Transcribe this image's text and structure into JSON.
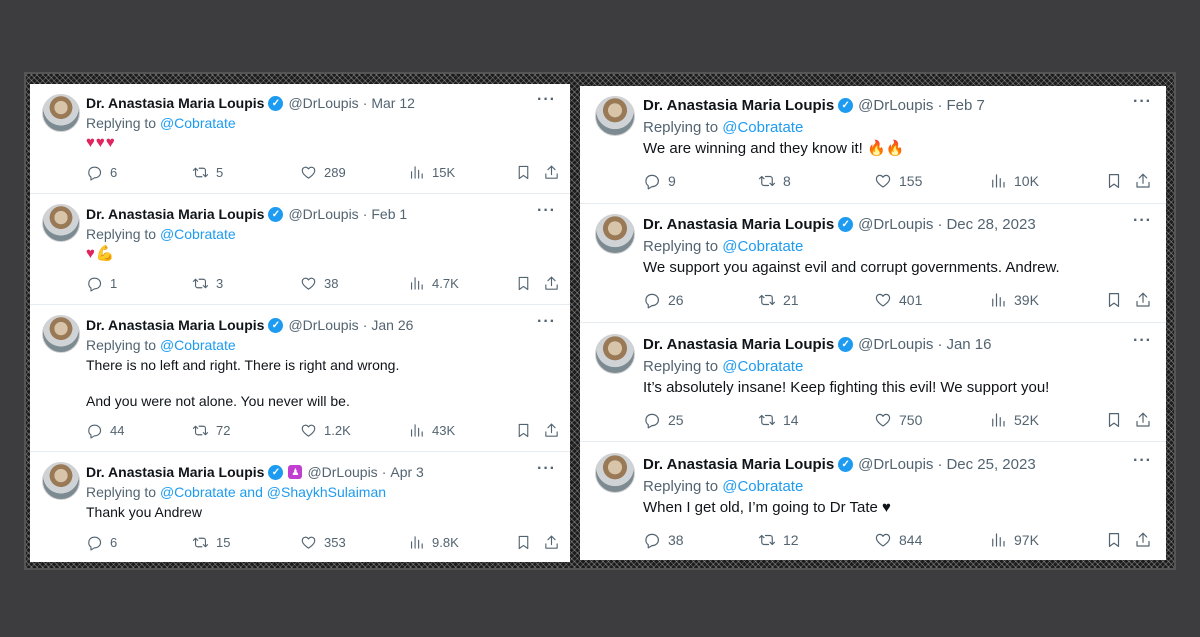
{
  "colors": {
    "link": "#1d9bf0",
    "verified": "#1d9bf0",
    "heart": "#e0245e",
    "text": "#0f1419",
    "muted": "#536471"
  },
  "icons": {
    "reply": "speech-bubble-icon",
    "retweet": "retweet-icon",
    "like": "heart-icon",
    "views": "bar-chart-icon",
    "bookmark": "bookmark-icon",
    "share": "share-upload-icon",
    "more": "ellipsis-icon",
    "verified": "verified-badge-icon"
  },
  "left_tweets": [
    {
      "name": "Dr. Anastasia Maria Loupis",
      "handle": "@DrLoupis",
      "separator": "·",
      "date": "Mar 12",
      "replying_prefix": "Replying to",
      "replying_to": "@Cobratate",
      "text": "♥♥♥",
      "emoji_text": true,
      "replies": "6",
      "retweets": "5",
      "likes": "289",
      "views": "15K"
    },
    {
      "name": "Dr. Anastasia Maria Loupis",
      "handle": "@DrLoupis",
      "separator": "·",
      "date": "Feb 1",
      "replying_prefix": "Replying to",
      "replying_to": "@Cobratate",
      "text": "♥💪",
      "emoji_text": true,
      "replies": "1",
      "retweets": "3",
      "likes": "38",
      "views": "4.7K"
    },
    {
      "name": "Dr. Anastasia Maria Loupis",
      "handle": "@DrLoupis",
      "separator": "·",
      "date": "Jan 26",
      "replying_prefix": "Replying to",
      "replying_to": "@Cobratate",
      "text": "There is no left and right. There is right and wrong.\n\nAnd you were not alone. You never will be.",
      "replies": "44",
      "retweets": "72",
      "likes": "1.2K",
      "views": "43K"
    },
    {
      "name": "Dr. Anastasia Maria Loupis",
      "handle": "@DrLoupis",
      "separator": "·",
      "date": "Apr 3",
      "replying_prefix": "Replying to",
      "replying_to": "@Cobratate and @ShaykhSulaiman",
      "text": "Thank you Andrew",
      "affiliate_badge": true,
      "replies": "6",
      "retweets": "15",
      "likes": "353",
      "views": "9.8K"
    }
  ],
  "right_tweets": [
    {
      "name": "Dr. Anastasia Maria Loupis",
      "handle": "@DrLoupis",
      "separator": "·",
      "date": "Feb 7",
      "replying_prefix": "Replying to",
      "replying_to": "@Cobratate",
      "text": "We are winning and they know it! 🔥🔥",
      "replies": "9",
      "retweets": "8",
      "likes": "155",
      "views": "10K"
    },
    {
      "name": "Dr. Anastasia Maria Loupis",
      "handle": "@DrLoupis",
      "separator": "·",
      "date": "Dec 28, 2023",
      "replying_prefix": "Replying to",
      "replying_to": "@Cobratate",
      "text": "We support you against evil and corrupt governments. Andrew.",
      "replies": "26",
      "retweets": "21",
      "likes": "401",
      "views": "39K"
    },
    {
      "name": "Dr. Anastasia Maria Loupis",
      "handle": "@DrLoupis",
      "separator": "·",
      "date": "Jan 16",
      "replying_prefix": "Replying to",
      "replying_to": "@Cobratate",
      "text": "It’s absolutely insane! Keep fighting this evil! We support you!",
      "replies": "25",
      "retweets": "14",
      "likes": "750",
      "views": "52K"
    },
    {
      "name": "Dr. Anastasia Maria Loupis",
      "handle": "@DrLoupis",
      "separator": "·",
      "date": "Dec 25, 2023",
      "replying_prefix": "Replying to",
      "replying_to": "@Cobratate",
      "text": "When I get old, I’m going to Dr Tate ♥",
      "replies": "38",
      "retweets": "12",
      "likes": "844",
      "views": "97K"
    }
  ]
}
